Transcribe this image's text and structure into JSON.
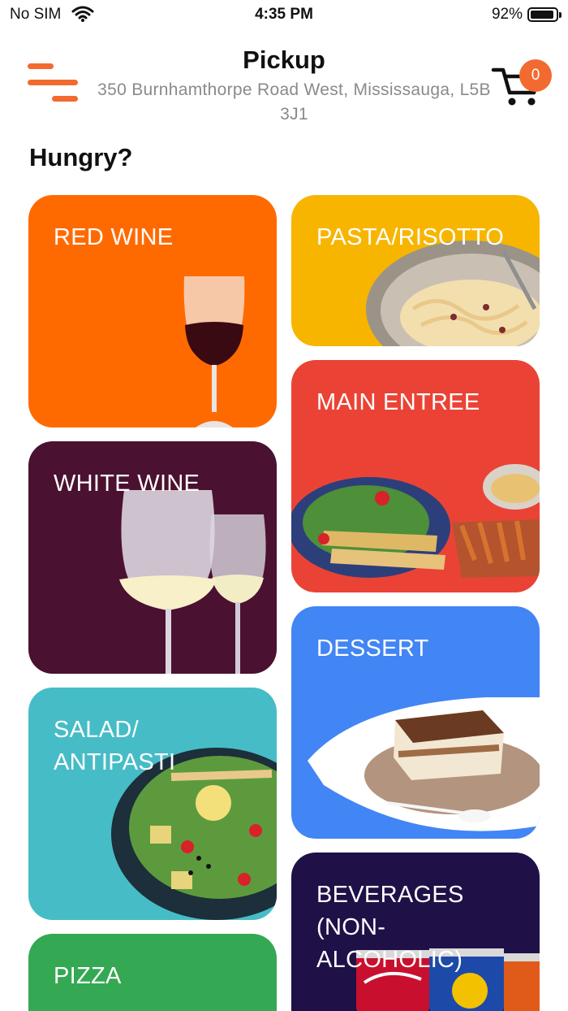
{
  "status_bar": {
    "carrier": "No SIM",
    "time": "4:35 PM",
    "battery_percent": "92%",
    "battery_level": 0.92
  },
  "header": {
    "title": "Pickup",
    "address": "350 Burnhamthorpe Road West, Mississauga, L5B 3J1",
    "cart_count": "0",
    "accent_color": "#f26a30"
  },
  "section": {
    "heading": "Hungry?"
  },
  "categories": [
    {
      "label": "RED WINE",
      "color": "#ff6a00",
      "icon": "red-wine-glass"
    },
    {
      "label": "PASTA/RISOTTO",
      "color": "#f7b500",
      "icon": "pasta-bowl"
    },
    {
      "label": "MAIN ENTREE",
      "color": "#ea4335",
      "icon": "entree-plate"
    },
    {
      "label": "WHITE WINE",
      "color": "#4b1130",
      "icon": "white-wine-glasses"
    },
    {
      "label": "DESSERT",
      "color": "#4285f4",
      "icon": "tiramisu-plate"
    },
    {
      "label": "SALAD/\nANTIPASTI",
      "color": "#46bcc6",
      "icon": "salad-bowl"
    },
    {
      "label": "BEVERAGES\n(NON-\nALCOHOLIC)",
      "color": "#1f1147",
      "icon": "soda-cans"
    },
    {
      "label": "PIZZA",
      "color": "#34a853",
      "icon": "pizza"
    }
  ]
}
